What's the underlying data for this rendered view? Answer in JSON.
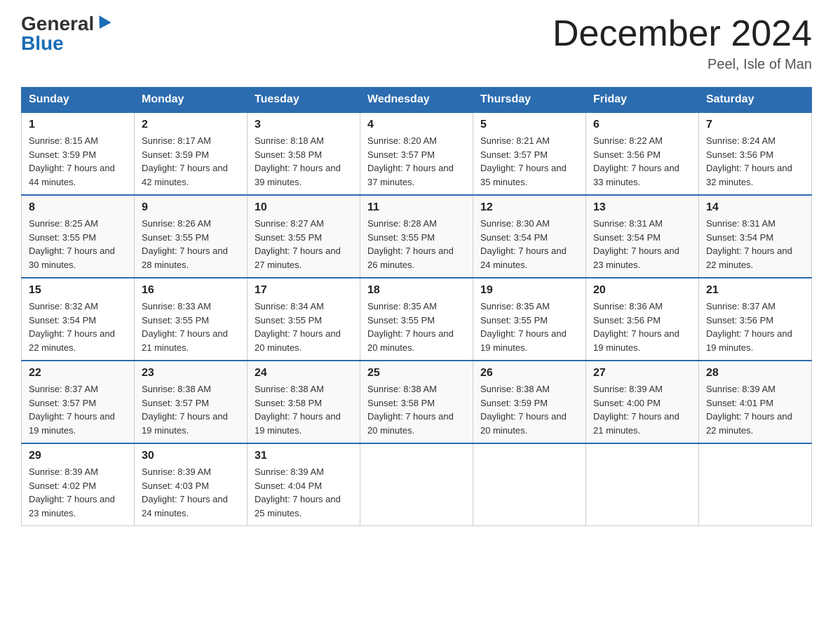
{
  "header": {
    "logo_general": "General",
    "logo_blue": "Blue",
    "month_title": "December 2024",
    "location": "Peel, Isle of Man"
  },
  "days_of_week": [
    "Sunday",
    "Monday",
    "Tuesday",
    "Wednesday",
    "Thursday",
    "Friday",
    "Saturday"
  ],
  "weeks": [
    [
      {
        "day": "1",
        "sunrise": "8:15 AM",
        "sunset": "3:59 PM",
        "daylight": "7 hours and 44 minutes."
      },
      {
        "day": "2",
        "sunrise": "8:17 AM",
        "sunset": "3:59 PM",
        "daylight": "7 hours and 42 minutes."
      },
      {
        "day": "3",
        "sunrise": "8:18 AM",
        "sunset": "3:58 PM",
        "daylight": "7 hours and 39 minutes."
      },
      {
        "day": "4",
        "sunrise": "8:20 AM",
        "sunset": "3:57 PM",
        "daylight": "7 hours and 37 minutes."
      },
      {
        "day": "5",
        "sunrise": "8:21 AM",
        "sunset": "3:57 PM",
        "daylight": "7 hours and 35 minutes."
      },
      {
        "day": "6",
        "sunrise": "8:22 AM",
        "sunset": "3:56 PM",
        "daylight": "7 hours and 33 minutes."
      },
      {
        "day": "7",
        "sunrise": "8:24 AM",
        "sunset": "3:56 PM",
        "daylight": "7 hours and 32 minutes."
      }
    ],
    [
      {
        "day": "8",
        "sunrise": "8:25 AM",
        "sunset": "3:55 PM",
        "daylight": "7 hours and 30 minutes."
      },
      {
        "day": "9",
        "sunrise": "8:26 AM",
        "sunset": "3:55 PM",
        "daylight": "7 hours and 28 minutes."
      },
      {
        "day": "10",
        "sunrise": "8:27 AM",
        "sunset": "3:55 PM",
        "daylight": "7 hours and 27 minutes."
      },
      {
        "day": "11",
        "sunrise": "8:28 AM",
        "sunset": "3:55 PM",
        "daylight": "7 hours and 26 minutes."
      },
      {
        "day": "12",
        "sunrise": "8:30 AM",
        "sunset": "3:54 PM",
        "daylight": "7 hours and 24 minutes."
      },
      {
        "day": "13",
        "sunrise": "8:31 AM",
        "sunset": "3:54 PM",
        "daylight": "7 hours and 23 minutes."
      },
      {
        "day": "14",
        "sunrise": "8:31 AM",
        "sunset": "3:54 PM",
        "daylight": "7 hours and 22 minutes."
      }
    ],
    [
      {
        "day": "15",
        "sunrise": "8:32 AM",
        "sunset": "3:54 PM",
        "daylight": "7 hours and 22 minutes."
      },
      {
        "day": "16",
        "sunrise": "8:33 AM",
        "sunset": "3:55 PM",
        "daylight": "7 hours and 21 minutes."
      },
      {
        "day": "17",
        "sunrise": "8:34 AM",
        "sunset": "3:55 PM",
        "daylight": "7 hours and 20 minutes."
      },
      {
        "day": "18",
        "sunrise": "8:35 AM",
        "sunset": "3:55 PM",
        "daylight": "7 hours and 20 minutes."
      },
      {
        "day": "19",
        "sunrise": "8:35 AM",
        "sunset": "3:55 PM",
        "daylight": "7 hours and 19 minutes."
      },
      {
        "day": "20",
        "sunrise": "8:36 AM",
        "sunset": "3:56 PM",
        "daylight": "7 hours and 19 minutes."
      },
      {
        "day": "21",
        "sunrise": "8:37 AM",
        "sunset": "3:56 PM",
        "daylight": "7 hours and 19 minutes."
      }
    ],
    [
      {
        "day": "22",
        "sunrise": "8:37 AM",
        "sunset": "3:57 PM",
        "daylight": "7 hours and 19 minutes."
      },
      {
        "day": "23",
        "sunrise": "8:38 AM",
        "sunset": "3:57 PM",
        "daylight": "7 hours and 19 minutes."
      },
      {
        "day": "24",
        "sunrise": "8:38 AM",
        "sunset": "3:58 PM",
        "daylight": "7 hours and 19 minutes."
      },
      {
        "day": "25",
        "sunrise": "8:38 AM",
        "sunset": "3:58 PM",
        "daylight": "7 hours and 20 minutes."
      },
      {
        "day": "26",
        "sunrise": "8:38 AM",
        "sunset": "3:59 PM",
        "daylight": "7 hours and 20 minutes."
      },
      {
        "day": "27",
        "sunrise": "8:39 AM",
        "sunset": "4:00 PM",
        "daylight": "7 hours and 21 minutes."
      },
      {
        "day": "28",
        "sunrise": "8:39 AM",
        "sunset": "4:01 PM",
        "daylight": "7 hours and 22 minutes."
      }
    ],
    [
      {
        "day": "29",
        "sunrise": "8:39 AM",
        "sunset": "4:02 PM",
        "daylight": "7 hours and 23 minutes."
      },
      {
        "day": "30",
        "sunrise": "8:39 AM",
        "sunset": "4:03 PM",
        "daylight": "7 hours and 24 minutes."
      },
      {
        "day": "31",
        "sunrise": "8:39 AM",
        "sunset": "4:04 PM",
        "daylight": "7 hours and 25 minutes."
      },
      null,
      null,
      null,
      null
    ]
  ]
}
